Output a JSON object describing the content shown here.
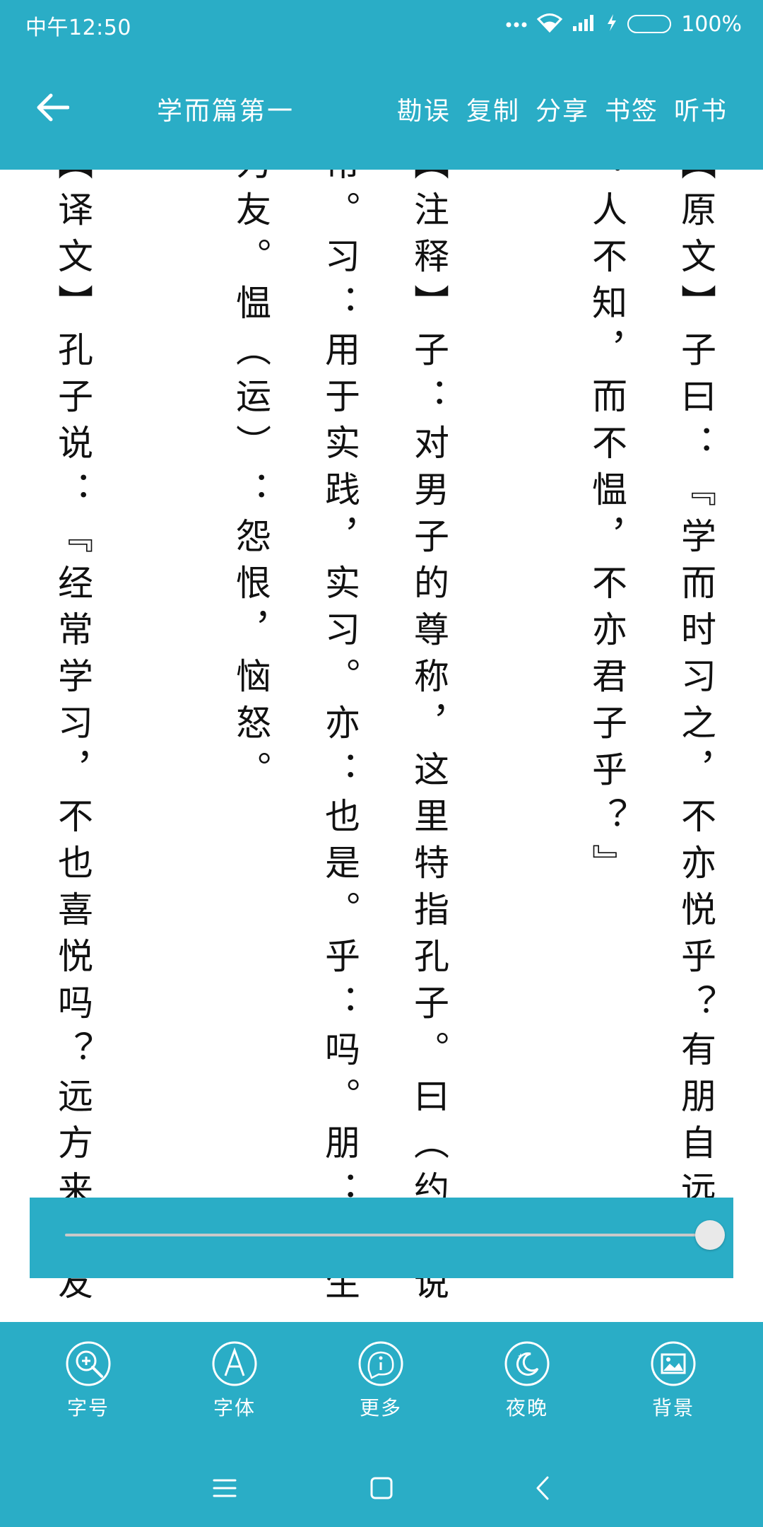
{
  "status_bar": {
    "time": "中午12:50",
    "battery_pct": "100%",
    "battery_color": "#57d36a"
  },
  "header": {
    "chapter_title": "学而篇第一",
    "actions": [
      "勘误",
      "复制",
      "分享",
      "书签",
      "听书"
    ]
  },
  "reader": {
    "columns": [
      "【原文】子曰：『学而时习之，不亦悦乎？有朋自远来",
      "：人不知，而不愠，不亦君子乎？』",
      "【注释】子：对男子的尊称，这里特指孔子。曰（约：说",
      "常。习：用于实践，实习。亦：也是。乎：吗。朋：学生",
      "为友。愠（运）：怨恨，恼怒。",
      "【译文】孔子说：『经常学习，不也喜悦吗？远方来朋友"
    ]
  },
  "slider": {
    "progress_pct": 100
  },
  "toolbar": {
    "items": [
      {
        "label": "字号",
        "icon": "font-size-icon"
      },
      {
        "label": "字体",
        "icon": "font-face-icon"
      },
      {
        "label": "更多",
        "icon": "info-icon"
      },
      {
        "label": "夜晚",
        "icon": "night-mode-icon"
      },
      {
        "label": "背景",
        "icon": "background-image-icon"
      }
    ]
  },
  "theme": {
    "accent": "#2aadc6"
  }
}
